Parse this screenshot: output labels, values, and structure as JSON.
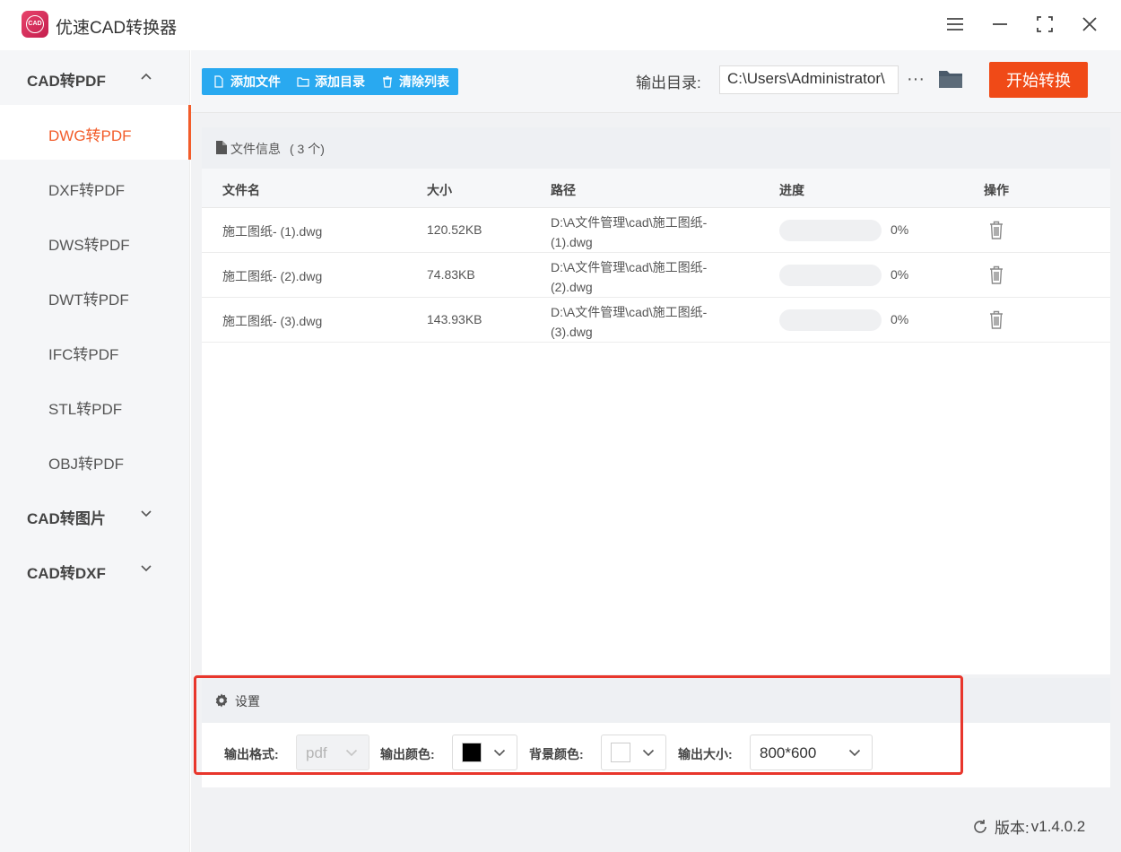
{
  "app": {
    "title": "优速CAD转换器",
    "logo_text": "CAD",
    "accent_color": "#f25c2a",
    "toolbar_blue": "#29a9f0",
    "start_color": "#f04a17",
    "window_controls": [
      "menu-icon",
      "minimize-icon",
      "fullscreen-icon",
      "close-icon"
    ]
  },
  "sidebar": {
    "groups": [
      {
        "label": "CAD转PDF",
        "expanded": true,
        "icon": "chevron-up-icon",
        "items": [
          {
            "label": "DWG转PDF",
            "active": true
          },
          {
            "label": "DXF转PDF"
          },
          {
            "label": "DWS转PDF"
          },
          {
            "label": "DWT转PDF"
          },
          {
            "label": "IFC转PDF"
          },
          {
            "label": "STL转PDF"
          },
          {
            "label": "OBJ转PDF"
          }
        ]
      },
      {
        "label": "CAD转图片",
        "expanded": false,
        "icon": "chevron-down-icon"
      },
      {
        "label": "CAD转DXF",
        "expanded": false,
        "icon": "chevron-down-icon"
      }
    ]
  },
  "toolbar": {
    "add_file": "添加文件",
    "add_dir": "添加目录",
    "clear_list": "清除列表",
    "output_label": "输出目录:",
    "output_path": "C:\\Users\\Administrator\\",
    "more": "···",
    "start": "开始转换"
  },
  "files": {
    "title": "文件信息",
    "count": "( 3 个)",
    "columns": [
      "文件名",
      "大小",
      "路径",
      "进度",
      "操作"
    ],
    "rows": [
      {
        "name": "施工图纸- (1).dwg",
        "size": "120.52KB",
        "path_line1": "D:\\A文件管理\\cad\\施工图纸-",
        "path_line2": "(1).dwg",
        "progress": 0,
        "percent": "0%"
      },
      {
        "name": "施工图纸- (2).dwg",
        "size": "74.83KB",
        "path_line1": "D:\\A文件管理\\cad\\施工图纸-",
        "path_line2": "(2).dwg",
        "progress": 0,
        "percent": "0%"
      },
      {
        "name": "施工图纸- (3).dwg",
        "size": "143.93KB",
        "path_line1": "D:\\A文件管理\\cad\\施工图纸-",
        "path_line2": "(3).dwg",
        "progress": 0,
        "percent": "0%"
      }
    ]
  },
  "settings": {
    "title": "设置",
    "format_label": "输出格式:",
    "format_value": "pdf",
    "color_label": "输出颜色:",
    "color_value": "#000000",
    "bg_label": "背景颜色:",
    "bg_value": "#ffffff",
    "size_label": "输出大小:",
    "size_value": "800*600"
  },
  "footer": {
    "version_label": "版本:",
    "version": "v1.4.0.2"
  }
}
